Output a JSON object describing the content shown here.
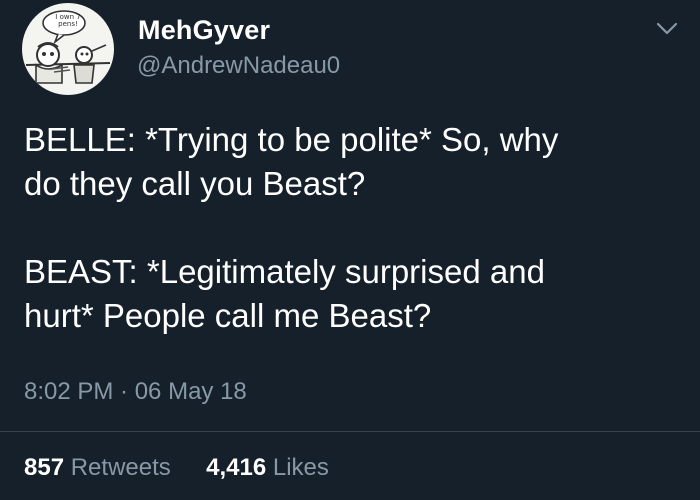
{
  "author": {
    "display_name": "MehGyver",
    "handle": "@AndrewNadeau0",
    "avatar_text": "I own 7 pens!"
  },
  "tweet": {
    "paragraph_1_line_1": "BELLE: *Trying to be polite* So, why",
    "paragraph_1_line_2": "do they call you Beast?",
    "paragraph_2_line_1": "BEAST: *Legitimately surprised and",
    "paragraph_2_line_2": "hurt* People call me Beast?",
    "timestamp": "8:02 PM · 06 May 18"
  },
  "stats": {
    "retweets_count": "857",
    "retweets_label": "Retweets",
    "likes_count": "4,416",
    "likes_label": "Likes"
  },
  "colors": {
    "background": "#15202b",
    "primary_text": "#ffffff",
    "secondary_text": "#8899a6",
    "divider": "#38444d"
  },
  "icons": {
    "menu": "chevron-down-icon"
  }
}
